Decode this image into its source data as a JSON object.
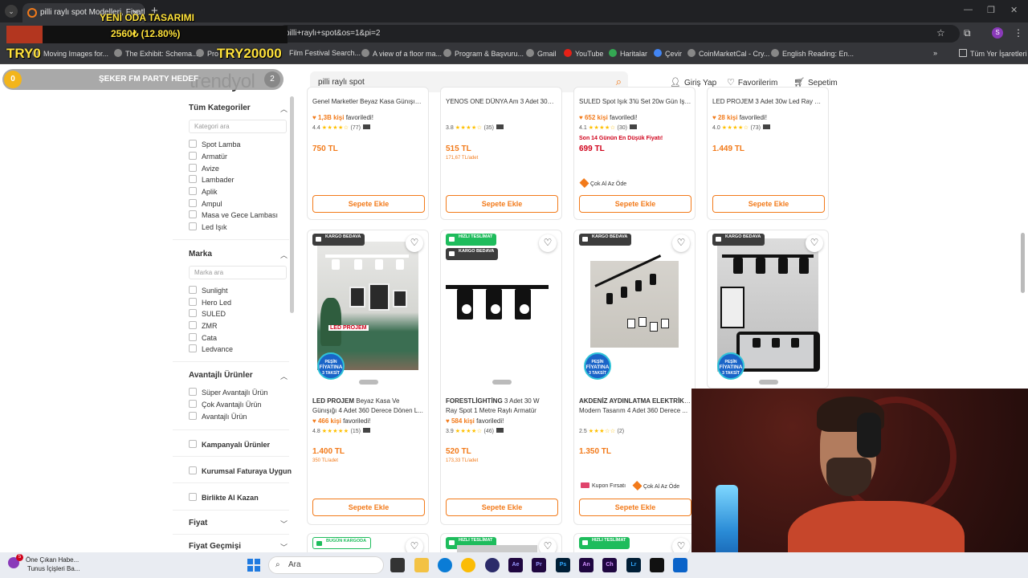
{
  "browser": {
    "tab_title": "pilli raylı spot Modelleri, Fiyatl",
    "tab_close": "✕",
    "new_tab": "+",
    "url": "pilli+raylı+spot&os=1&pi=2",
    "bookmarks": [
      "Moving Images for...",
      "The Exhibit: Schema...",
      "Pro",
      "Film Festival Search...",
      "A view of a floor ma...",
      "Program & Başvuru...",
      "Gmail",
      "YouTube",
      "Haritalar",
      "Çevir",
      "CoinMarketCal - Cry...",
      "English Reading: En..."
    ],
    "more": "»",
    "all_bookmarks": "Tüm Yer İşaretleri",
    "profile_initial": "S"
  },
  "overlay": {
    "title": "YENİ ODA TASARIMI",
    "progress_text": "2560₺ (12.80%)",
    "progress_fraction": 0.128,
    "left_label": "TRY0",
    "right_label": "TRY20000",
    "event": "ŞEKER FM PARTY HEDEF",
    "event_coin": "0",
    "event_count": "2"
  },
  "site": {
    "logo": "trendyol",
    "search_value": "pilli raylı spot",
    "login": "Giriş Yap",
    "favorites": "Favorilerim",
    "cart": "Sepetim"
  },
  "sidebar": {
    "categories_title": "Tüm Kategoriler",
    "category_search_placeholder": "Kategori ara",
    "categories": [
      "Spot Lamba",
      "Armatür",
      "Avize",
      "Lambader",
      "Aplik",
      "Ampul",
      "Masa ve Gece Lambası",
      "Led Işık"
    ],
    "brand_title": "Marka",
    "brand_search_placeholder": "Marka ara",
    "brands": [
      "Sunlight",
      "Hero Led",
      "SULED",
      "ZMR",
      "Cata",
      "Ledvance"
    ],
    "advantage_title": "Avantajlı Ürünler",
    "advantage_options": [
      "Süper Avantajlı Ürün",
      "Çok Avantajlı Ürün",
      "Avantajlı Ürün"
    ],
    "campaign": "Kampanyalı Ürünler",
    "corporate": "Kurumsal Faturaya Uygun",
    "together": "Birlikte Al Kazan",
    "price": "Fiyat",
    "price_history": "Fiyat Geçmişi"
  },
  "row1": [
    {
      "brand": "",
      "name": "Genel Marketler Beyaz Kasa Günışığı 30w 3 Adet 360 Dönen Ray ...",
      "fav_count": "1,3B kişi",
      "fav_suffix": "favoriledi!",
      "rating": "4.4",
      "stars": "★★★★☆",
      "reviews": "(77)",
      "price": "750 TL",
      "unit": "",
      "note": "",
      "promo": "",
      "button": "Sepete Ekle"
    },
    {
      "brand": "",
      "name": "YENOS ONE DÜNYA Am 3 Adet 30w Ray Spot Vitrin Mağaza Aydınla...",
      "fav_count": "",
      "fav_suffix": "",
      "rating": "3.8",
      "stars": "★★★★☆",
      "reviews": "(35)",
      "price": "515 TL",
      "unit": "171,67 TL/adet",
      "note": "",
      "promo": "",
      "button": "Sepete Ekle"
    },
    {
      "brand": "",
      "name": "SULED Spot Işık 3'lü Set 20w Gün Işığı Beyaz Kasa 20w 1 Metre Ra...",
      "fav_count": "652 kişi",
      "fav_suffix": "favoriledi!",
      "rating": "4.1",
      "stars": "★★★★☆",
      "reviews": "(30)",
      "price": "699 TL",
      "unit": "",
      "note": "Son 14 Günün En Düşük Fiyatı!",
      "promo": "Çok Al Az Öde",
      "button": "Sepete Ekle"
    },
    {
      "brand": "",
      "name": "LED PROJEM 3 Adet 30w Led Ray Spot Vitrin Mağaza Armatürü 2 Adet ...",
      "fav_count": "28 kişi",
      "fav_suffix": "favoriledi!",
      "rating": "4.0",
      "stars": "★★★★☆",
      "reviews": "(73)",
      "price": "1.449 TL",
      "unit": "",
      "note": "",
      "promo": "",
      "button": "Sepete Ekle"
    }
  ],
  "row2": [
    {
      "badge1": "KARGO BEDAVA",
      "badge2": "",
      "brand": "LED PROJEM",
      "name": "Beyaz Kasa Ve",
      "name2": "Günışığı 4 Adet 360 Derece Dönen L...",
      "fav_count": "466 kişi",
      "fav_suffix": "favoriledi!",
      "rating": "4.8",
      "stars": "★★★★★",
      "reviews": "(15)",
      "price": "1.400 TL",
      "unit": "350 TL/adet",
      "promos": [],
      "button": "Sepete Ekle",
      "img_label": "LED PROJEM"
    },
    {
      "badge1": "HIZLI TESLİMAT",
      "badge2": "KARGO BEDAVA",
      "brand": "FORESTLİGHTİNG",
      "name": "3 Adet 30 W",
      "name2": "Ray Spot 1 Metre Raylı Armatür",
      "fav_count": "584 kişi",
      "fav_suffix": "favoriledi!",
      "rating": "3.9",
      "stars": "★★★★☆",
      "reviews": "(46)",
      "price": "520 TL",
      "unit": "173,33 TL/adet",
      "promos": [],
      "button": "Sepete Ekle",
      "img_label": ""
    },
    {
      "badge1": "KARGO BEDAVA",
      "badge2": "",
      "brand": "AKDENİZ AYDINLATMA ELEKTRİK M...",
      "name": "",
      "name2": "Modern Tasarım 4 Adet 360 Derece ...",
      "fav_count": "",
      "fav_suffix": "",
      "rating": "2.5",
      "stars": "★★★☆☆",
      "reviews": "(2)",
      "price": "1.350 TL",
      "unit": "",
      "promos": [
        "Kupon Fırsatı",
        "Çok Al Az Öde"
      ],
      "button": "Sepete Ekle",
      "img_label": ""
    },
    {
      "badge1": "KARGO BEDAVA",
      "badge2": "",
      "brand": "",
      "name": "",
      "name2": "",
      "fav_count": "",
      "fav_suffix": "",
      "rating": "",
      "stars": "",
      "reviews": "",
      "price": "",
      "unit": "",
      "promos": [],
      "button": "",
      "img_label": ""
    }
  ],
  "pesin": {
    "line1": "PEŞİN",
    "line2": "FİYATINA",
    "line3": "3 TAKSİT"
  },
  "row3_badges": [
    "BUGÜN KARGODA",
    "HIZLI TESLİMAT",
    "HIZLI TESLİMAT"
  ],
  "taskbar": {
    "news_title": "Öne Çıkan Habe...",
    "news_sub": "Tunus İçişleri Ba...",
    "news_count": "5",
    "search": "Ara",
    "apps": [
      "Ae",
      "Pr",
      "Ps",
      "An",
      "Ch",
      "Lr"
    ]
  },
  "colors": {
    "brand_orange": "#f27a1a",
    "overlay_yellow": "#ffe23b",
    "fast_delivery_green": "#1ebc5c"
  }
}
